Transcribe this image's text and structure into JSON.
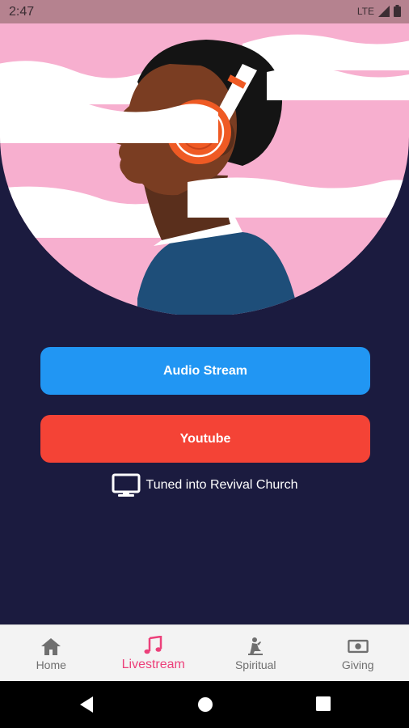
{
  "status": {
    "time": "2:47",
    "network": "LTE"
  },
  "buttons": {
    "audio_stream": "Audio Stream",
    "youtube": "Youtube"
  },
  "tuned_text": "Tuned into Revival Church",
  "nav": {
    "items": [
      {
        "label": "Home",
        "icon": "home-icon"
      },
      {
        "label": "Livestream",
        "icon": "music-note-icon",
        "active": true
      },
      {
        "label": "Spiritual",
        "icon": "praying-icon"
      },
      {
        "label": "Giving",
        "icon": "money-icon"
      }
    ]
  },
  "colors": {
    "background": "#1b1b3f",
    "hero_pink": "#f7afcf",
    "audio_button": "#2196f3",
    "youtube_button": "#f44336",
    "nav_active": "#ec407a"
  }
}
